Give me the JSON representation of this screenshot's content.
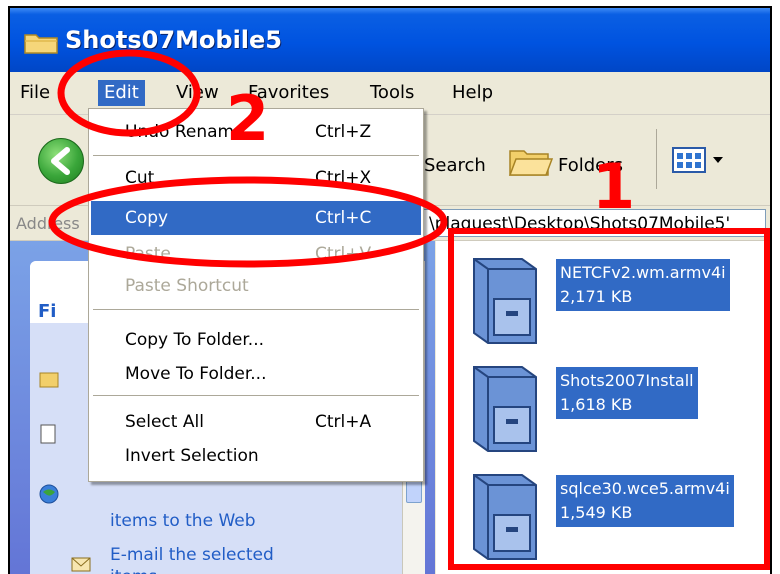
{
  "window": {
    "title": "Shots07Mobile5"
  },
  "menubar": {
    "items": [
      "File",
      "Edit",
      "View",
      "Favorites",
      "Tools",
      "Help"
    ],
    "active": "Edit"
  },
  "toolbar": {
    "search_label": "Search",
    "folders_label": "Folders"
  },
  "addressbar": {
    "label": "Address",
    "path": "\\plaguest\\Desktop\\Shots07Mobile5'"
  },
  "edit_menu": {
    "items": [
      {
        "label": "Undo Rename",
        "shortcut": "Ctrl+Z",
        "state": "normal"
      },
      {
        "label": "Cut",
        "shortcut": "Ctrl+X",
        "state": "normal"
      },
      {
        "label": "Copy",
        "shortcut": "Ctrl+C",
        "state": "highlighted"
      },
      {
        "label": "Paste",
        "shortcut": "Ctrl+V",
        "state": "disabled"
      },
      {
        "label": "Paste Shortcut",
        "shortcut": "",
        "state": "disabled"
      },
      {
        "label": "Copy To Folder...",
        "shortcut": "",
        "state": "normal"
      },
      {
        "label": "Move To Folder...",
        "shortcut": "",
        "state": "normal"
      },
      {
        "label": "Select All",
        "shortcut": "Ctrl+A",
        "state": "normal"
      },
      {
        "label": "Invert Selection",
        "shortcut": "",
        "state": "normal"
      }
    ]
  },
  "task_pane": {
    "section_title": "Fi",
    "link_publish": "items to the Web",
    "link_email_1": "E-mail the selected",
    "link_email_2": "items"
  },
  "files": [
    {
      "name": "NETCFv2.wm.armv4i",
      "size": "2,171 KB"
    },
    {
      "name": "Shots2007Install",
      "size": "1,618 KB"
    },
    {
      "name": "sqlce30.wce5.armv4i",
      "size": "1,549 KB"
    }
  ],
  "annotations": {
    "step1": "1",
    "step2": "2"
  },
  "colors": {
    "titlebar": "#0053e0",
    "selection": "#316ac5",
    "annotation": "#ff0000",
    "menu_bg": "#ece9d8"
  }
}
